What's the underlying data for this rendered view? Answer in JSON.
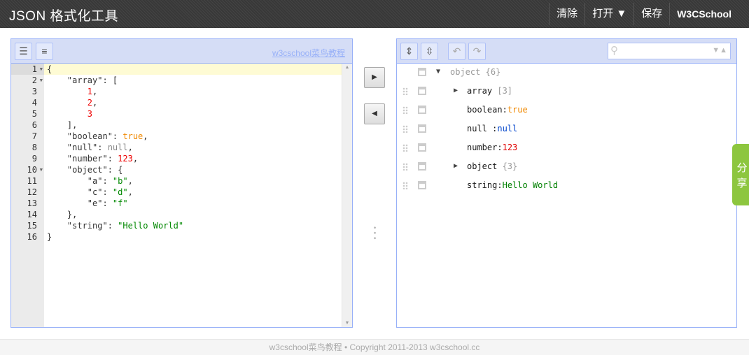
{
  "header": {
    "title": "JSON 格式化工具",
    "nav": [
      "清除",
      "打开 ▼",
      "保存",
      "W3CSchool"
    ]
  },
  "left_panel": {
    "link": "w3cschool菜鸟教程",
    "lines": [
      [
        {
          "t": "{",
          "c": "k"
        }
      ],
      [
        {
          "t": "    \"array\": [",
          "c": "k"
        }
      ],
      [
        {
          "t": "        ",
          "c": "k"
        },
        {
          "t": "1",
          "c": "n"
        },
        {
          "t": ",",
          "c": "k"
        }
      ],
      [
        {
          "t": "        ",
          "c": "k"
        },
        {
          "t": "2",
          "c": "n"
        },
        {
          "t": ",",
          "c": "k"
        }
      ],
      [
        {
          "t": "        ",
          "c": "k"
        },
        {
          "t": "3",
          "c": "n"
        }
      ],
      [
        {
          "t": "    ],",
          "c": "k"
        }
      ],
      [
        {
          "t": "    \"boolean\": ",
          "c": "k"
        },
        {
          "t": "true",
          "c": "b"
        },
        {
          "t": ",",
          "c": "k"
        }
      ],
      [
        {
          "t": "    \"null\": ",
          "c": "k"
        },
        {
          "t": "null",
          "c": "nl"
        },
        {
          "t": ",",
          "c": "k"
        }
      ],
      [
        {
          "t": "    \"number\": ",
          "c": "k"
        },
        {
          "t": "123",
          "c": "n"
        },
        {
          "t": ",",
          "c": "k"
        }
      ],
      [
        {
          "t": "    \"object\": {",
          "c": "k"
        }
      ],
      [
        {
          "t": "        \"a\": ",
          "c": "k"
        },
        {
          "t": "\"b\"",
          "c": "s"
        },
        {
          "t": ",",
          "c": "k"
        }
      ],
      [
        {
          "t": "        \"c\": ",
          "c": "k"
        },
        {
          "t": "\"d\"",
          "c": "s"
        },
        {
          "t": ",",
          "c": "k"
        }
      ],
      [
        {
          "t": "        \"e\": ",
          "c": "k"
        },
        {
          "t": "\"f\"",
          "c": "s"
        }
      ],
      [
        {
          "t": "    },",
          "c": "k"
        }
      ],
      [
        {
          "t": "    \"string\": ",
          "c": "k"
        },
        {
          "t": "\"Hello World\"",
          "c": "s"
        }
      ],
      [
        {
          "t": "}",
          "c": "k"
        }
      ]
    ],
    "foldable": [
      1,
      2,
      10
    ]
  },
  "tree": {
    "root": {
      "key": "object",
      "meta": "{6}"
    },
    "rows": [
      {
        "key": "array",
        "meta": "[3]",
        "expandable": true
      },
      {
        "key": "boolean",
        "sep": ":",
        "value": "true",
        "color": "#f08800"
      },
      {
        "key": "null",
        "sep": " :",
        "value": "null",
        "color": "#0044cc"
      },
      {
        "key": "number",
        "sep": ":",
        "value": "123",
        "color": "#e00000"
      },
      {
        "key": "object",
        "meta": "{3}",
        "expandable": true
      },
      {
        "key": "string",
        "sep": ":",
        "value": "Hello World",
        "color": "#008000"
      }
    ]
  },
  "share": [
    "分",
    "享"
  ],
  "footer": "w3cschool菜鸟教程 • Copyright 2011-2013 w3cschool.cc"
}
